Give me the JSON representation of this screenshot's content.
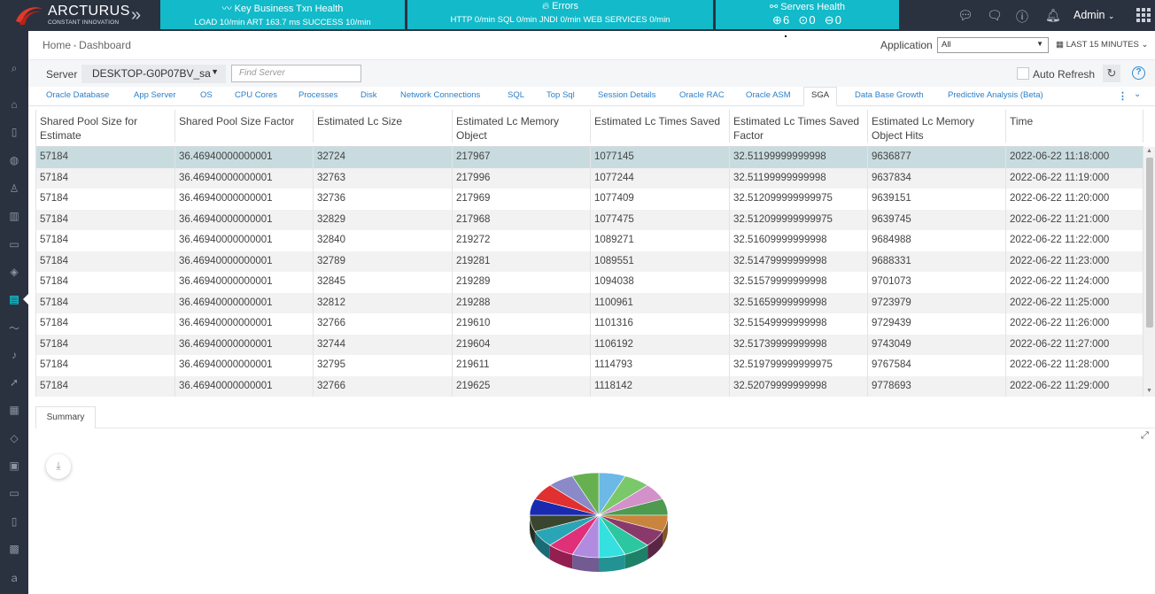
{
  "brand": {
    "name": "ARCTURUS",
    "tagline": "CONSTANT INNOVATION"
  },
  "health": {
    "txn": {
      "title": "Key Business Txn Health",
      "stats": "LOAD 10/min  ART 163.7 ms  SUCCESS 10/min"
    },
    "errors": {
      "title": "Errors",
      "stats": "HTTP 0/min  SQL 0/min  JNDI 0/min  WEB SERVICES 0/min"
    },
    "servers": {
      "title": "Servers Health",
      "up": "6",
      "warn": "0",
      "down": "0"
    }
  },
  "user": {
    "name": "Admin"
  },
  "breadcrumb": {
    "home": "Home",
    "current": "Dashboard"
  },
  "application": {
    "label": "Application",
    "value": "All"
  },
  "time_range": "LAST 15 MINUTES",
  "server": {
    "label": "Server",
    "value": "DESKTOP-G0P07BV_sa",
    "search_placeholder": "Find Server"
  },
  "auto_refresh_label": "Auto Refresh",
  "tabs": [
    "Oracle Database",
    "App Server",
    "OS",
    "CPU Cores",
    "Processes",
    "Disk",
    "Network Connections",
    "SQL",
    "Top Sql",
    "Session Details",
    "Oracle RAC",
    "Oracle ASM",
    "SGA",
    "Data Base Growth",
    "Predictive Analysis (Beta)"
  ],
  "active_tab": "SGA",
  "table": {
    "headers": [
      "Shared Pool Size for Estimate",
      "Shared Pool Size Factor",
      "Estimated Lc Size",
      "Estimated Lc Memory Object",
      "Estimated Lc Times Saved",
      "Estimated Lc Times Saved Factor",
      "Estimated Lc Memory Object Hits",
      "Time"
    ],
    "rows": [
      [
        "57184",
        "36.46940000000001",
        "32724",
        "217967",
        "1077145",
        "32.51199999999998",
        "9636877",
        "2022-06-22 11:18:000"
      ],
      [
        "57184",
        "36.46940000000001",
        "32763",
        "217996",
        "1077244",
        "32.51199999999998",
        "9637834",
        "2022-06-22 11:19:000"
      ],
      [
        "57184",
        "36.46940000000001",
        "32736",
        "217969",
        "1077409",
        "32.512099999999975",
        "9639151",
        "2022-06-22 11:20:000"
      ],
      [
        "57184",
        "36.46940000000001",
        "32829",
        "217968",
        "1077475",
        "32.512099999999975",
        "9639745",
        "2022-06-22 11:21:000"
      ],
      [
        "57184",
        "36.46940000000001",
        "32840",
        "219272",
        "1089271",
        "32.51609999999998",
        "9684988",
        "2022-06-22 11:22:000"
      ],
      [
        "57184",
        "36.46940000000001",
        "32789",
        "219281",
        "1089551",
        "32.51479999999998",
        "9688331",
        "2022-06-22 11:23:000"
      ],
      [
        "57184",
        "36.46940000000001",
        "32845",
        "219289",
        "1094038",
        "32.51579999999998",
        "9701073",
        "2022-06-22 11:24:000"
      ],
      [
        "57184",
        "36.46940000000001",
        "32812",
        "219288",
        "1100961",
        "32.51659999999998",
        "9723979",
        "2022-06-22 11:25:000"
      ],
      [
        "57184",
        "36.46940000000001",
        "32766",
        "219610",
        "1101316",
        "32.51549999999998",
        "9729439",
        "2022-06-22 11:26:000"
      ],
      [
        "57184",
        "36.46940000000001",
        "32744",
        "219604",
        "1106192",
        "32.51739999999998",
        "9743049",
        "2022-06-22 11:27:000"
      ],
      [
        "57184",
        "36.46940000000001",
        "32795",
        "219611",
        "1114793",
        "32.519799999999975",
        "9767584",
        "2022-06-22 11:28:000"
      ],
      [
        "57184",
        "36.46940000000001",
        "32766",
        "219625",
        "1118142",
        "32.52079999999998",
        "9778693",
        "2022-06-22 11:29:000"
      ]
    ]
  },
  "summary": {
    "tab_label": "Summary",
    "pie_colors": [
      "#6cb8e6",
      "#7bc86b",
      "#d291c8",
      "#4e9a4e",
      "#c9843e",
      "#8a3a6a",
      "#2cc7a0",
      "#35e0e0",
      "#b08be0",
      "#e0307a",
      "#2aa5b5",
      "#3a4530",
      "#1a2ab0",
      "#e03030",
      "#8a8ac8",
      "#67b04f"
    ]
  }
}
